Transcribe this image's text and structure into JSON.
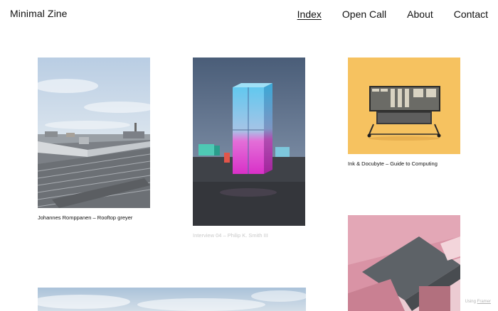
{
  "header": {
    "logo": "Minimal Zine",
    "nav": {
      "index": "Index",
      "open_call": "Open Call",
      "about": "About",
      "contact": "Contact"
    }
  },
  "posts": [
    {
      "caption": "Johannes Romppanen – Rooftop greyer"
    },
    {
      "caption": "Interview 04 – Philip K. Smith III"
    },
    {
      "caption": "Ink & Docubyte – Guide to Computing"
    }
  ],
  "badge": {
    "prefix": "Using",
    "link": "Framer"
  },
  "colors": {
    "accent_text": "#111111",
    "faded_caption": "#c9c9c9",
    "badge_text": "#b5b5b5"
  }
}
